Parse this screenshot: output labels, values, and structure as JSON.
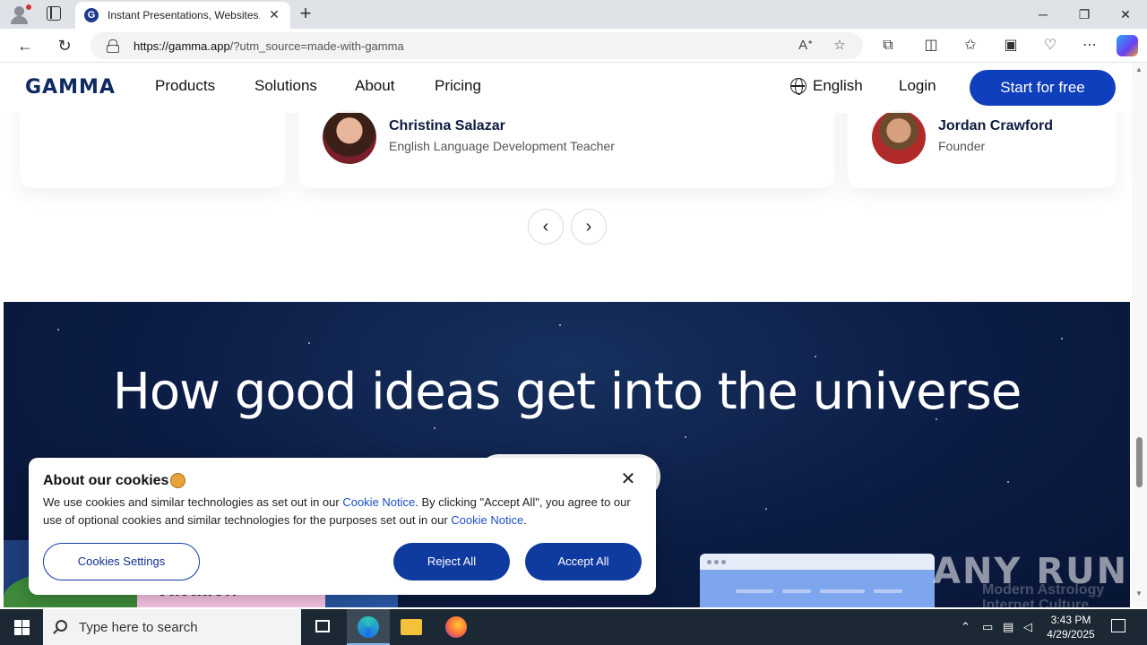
{
  "browser": {
    "tab_title": "Instant Presentations, Websites, &",
    "tab_favicon": "G",
    "url_domain": "https://gamma.app",
    "url_rest": "/?utm_source=made-with-gamma",
    "icons": [
      "profile-icon",
      "tab-actions-icon",
      "close-icon",
      "new-tab-icon",
      "minimize-icon",
      "restore-icon",
      "close-window-icon",
      "back-icon",
      "refresh-icon",
      "lock-icon",
      "read-aloud-icon",
      "favorite-icon",
      "extensions-icon",
      "split-screen-icon",
      "favorites-icon",
      "collections-icon",
      "performance-icon",
      "more-icon",
      "copilot-icon"
    ]
  },
  "site_nav": {
    "logo": "GAMMA",
    "links": [
      "Products",
      "Solutions",
      "About",
      "Pricing"
    ],
    "language": "English",
    "login": "Login",
    "cta": "Start for free"
  },
  "testimonials": [
    {
      "name": "Christina Salazar",
      "role": "English Language Development Teacher"
    },
    {
      "name": "Jordan Crawford",
      "role": "Founder"
    }
  ],
  "carousel": {
    "prev": "‹",
    "next": "›"
  },
  "hero": {
    "title": "How good ideas get into the universe",
    "vacation_text": "vacation"
  },
  "cookie_banner": {
    "title": "About our cookies",
    "text_1": "We use cookies and similar technologies as set out in our ",
    "link_1": "Cookie Notice",
    "text_2": ". By clicking \"Accept All\", you agree to our use of optional cookies and similar technologies for the purposes set out in our ",
    "link_2": "Cookie Notice",
    "text_3": ".",
    "settings": "Cookies Settings",
    "reject": "Reject All",
    "accept": "Accept All",
    "close": "✕"
  },
  "watermark": {
    "main": "ANY RUN",
    "sub": "Modern Astrology Internet Culture"
  },
  "taskbar": {
    "search_placeholder": "Type here to search",
    "time": "3:43 PM",
    "date": "4/29/2025"
  },
  "colors": {
    "brand": "#0f3fbd",
    "hero_bg": "#0b1c44",
    "cookie_link": "#1a4fc8"
  }
}
